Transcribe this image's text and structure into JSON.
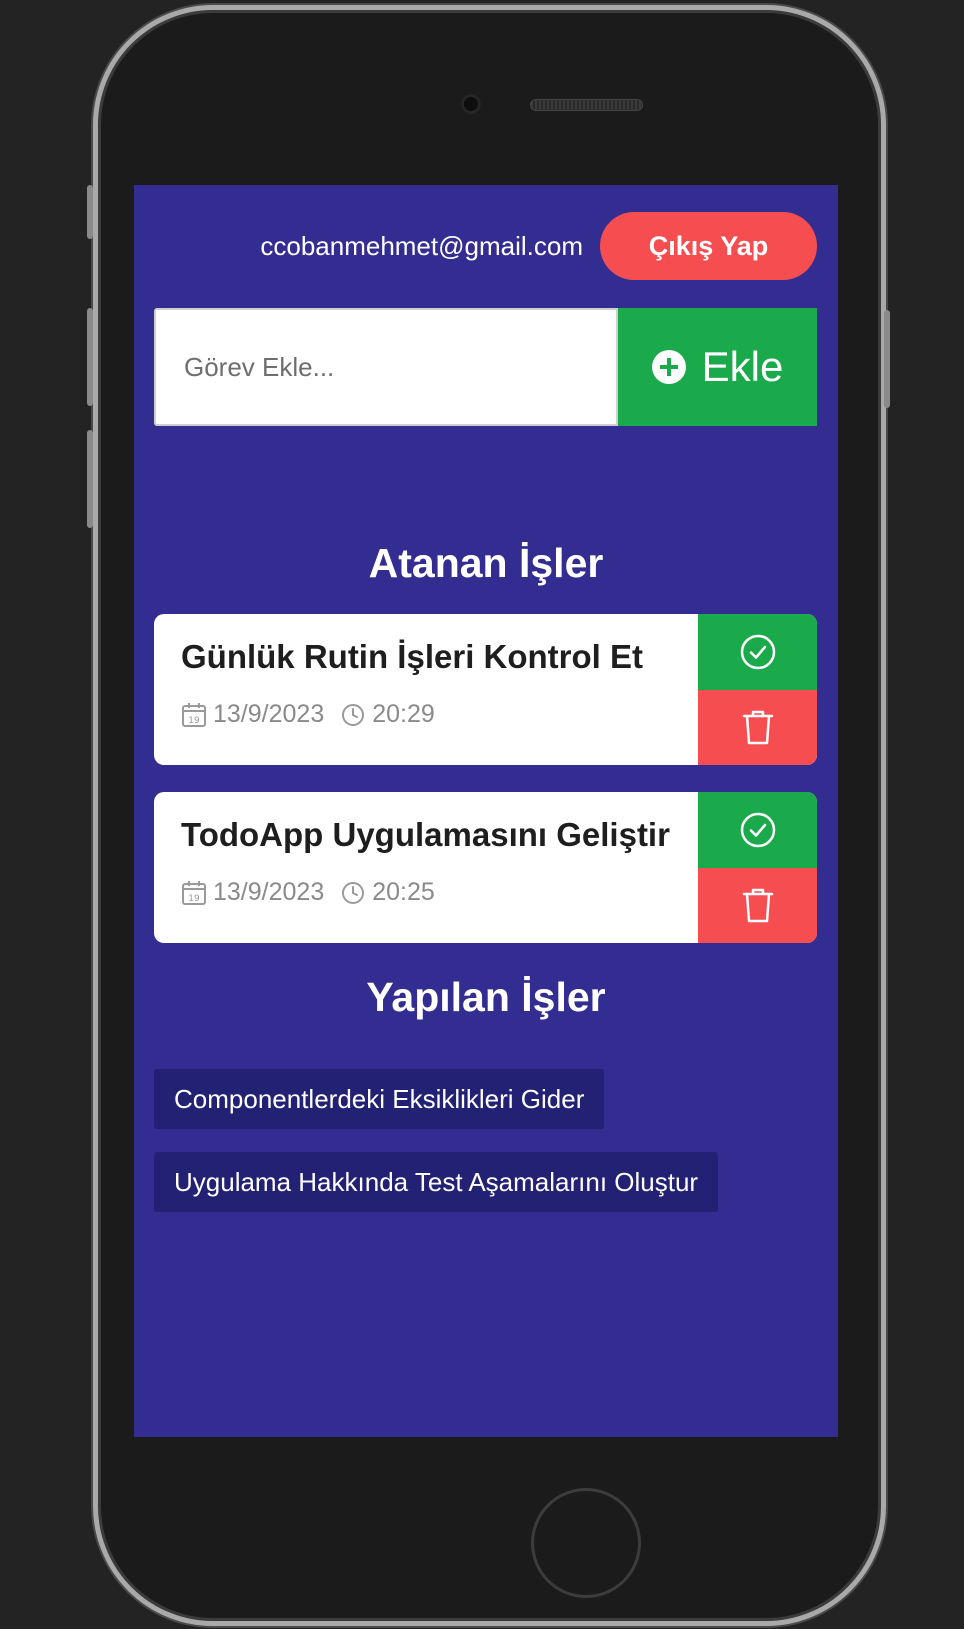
{
  "header": {
    "user_email": "ccobanmehmet@gmail.com",
    "logout_label": "Çıkış Yap"
  },
  "add_task": {
    "placeholder": "Görev Ekle...",
    "button_label": "Ekle"
  },
  "assigned": {
    "title": "Atanan İşler",
    "tasks": [
      {
        "title": "Günlük Rutin İşleri Kontrol Et",
        "date": "13/9/2023",
        "time": "20:29"
      },
      {
        "title": "TodoApp Uygulamasını Geliştir",
        "date": "13/9/2023",
        "time": "20:25"
      }
    ]
  },
  "done": {
    "title": "Yapılan İşler",
    "items": [
      "Componentlerdeki Eksiklikleri Gider",
      "Uygulama Hakkında Test Aşamalarını Oluştur"
    ]
  },
  "icons": {
    "calendar_day": "19",
    "add": "plus-circle-icon",
    "complete": "check-circle-icon",
    "delete": "trash-icon",
    "date": "calendar-icon",
    "time": "clock-icon"
  },
  "colors": {
    "screen_bg": "#332d91",
    "accent_green": "#1aaa4b",
    "accent_red": "#f64e50",
    "done_item_bg": "#232173"
  }
}
